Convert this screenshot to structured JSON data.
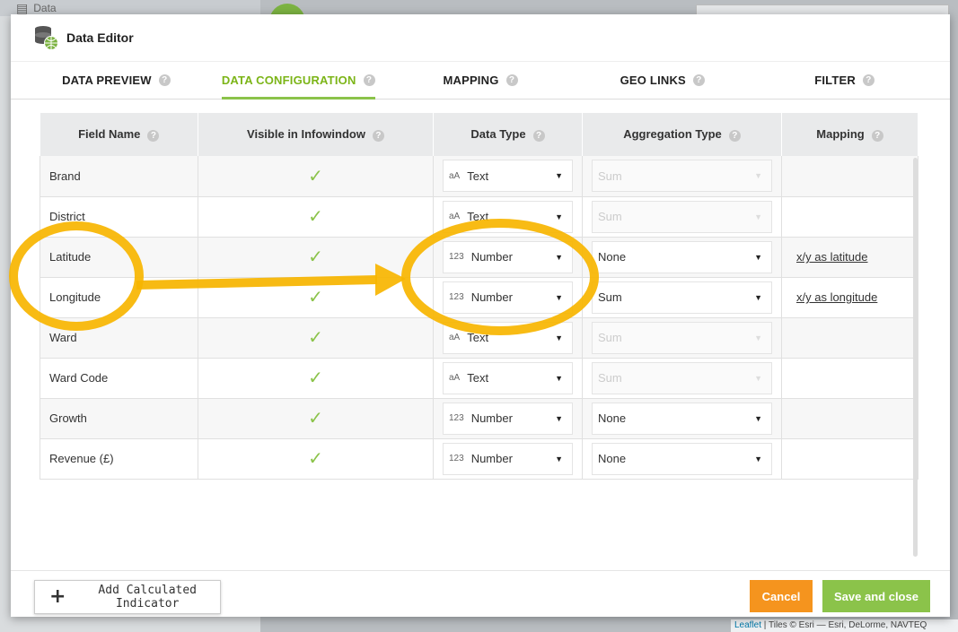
{
  "background": {
    "panel_title": "Data",
    "attribution_link": "Leaflet",
    "attribution_text": " | Tiles © Esri — Esri, DeLorme, NAVTEQ"
  },
  "dialog": {
    "title": "Data Editor",
    "tabs": [
      {
        "label": "DATA PREVIEW",
        "active": false
      },
      {
        "label": "DATA CONFIGURATION",
        "active": true
      },
      {
        "label": "MAPPING",
        "active": false
      },
      {
        "label": "GEO LINKS",
        "active": false
      },
      {
        "label": "FILTER",
        "active": false
      }
    ],
    "columns": {
      "field_name": "Field Name",
      "visible": "Visible in Infowindow",
      "data_type": "Data Type",
      "aggregation": "Aggregation Type",
      "mapping": "Mapping"
    },
    "rows": [
      {
        "field": "Brand",
        "type_icon": "aA",
        "type": "Text",
        "agg": "Sum",
        "agg_disabled": true,
        "mapping": ""
      },
      {
        "field": "District",
        "type_icon": "aA",
        "type": "Text",
        "agg": "Sum",
        "agg_disabled": true,
        "mapping": ""
      },
      {
        "field": "Latitude",
        "type_icon": "123",
        "type": "Number",
        "agg": "None",
        "agg_disabled": false,
        "mapping": "x/y as latitude"
      },
      {
        "field": "Longitude",
        "type_icon": "123",
        "type": "Number",
        "agg": "Sum",
        "agg_disabled": false,
        "mapping": "x/y as longitude"
      },
      {
        "field": "Ward",
        "type_icon": "aA",
        "type": "Text",
        "agg": "Sum",
        "agg_disabled": true,
        "mapping": ""
      },
      {
        "field": "Ward Code",
        "type_icon": "aA",
        "type": "Text",
        "agg": "Sum",
        "agg_disabled": true,
        "mapping": ""
      },
      {
        "field": "Growth",
        "type_icon": "123",
        "type": "Number",
        "agg": "None",
        "agg_disabled": false,
        "mapping": ""
      },
      {
        "field": "Revenue (£)",
        "type_icon": "123",
        "type": "Number",
        "agg": "None",
        "agg_disabled": false,
        "mapping": ""
      }
    ],
    "buttons": {
      "add_indicator": "Add Calculated Indicator",
      "cancel": "Cancel",
      "save": "Save and close"
    }
  },
  "colors": {
    "accent_green": "#8bc34a",
    "cancel_orange": "#f5941e",
    "annotation_yellow": "#f7b500"
  }
}
